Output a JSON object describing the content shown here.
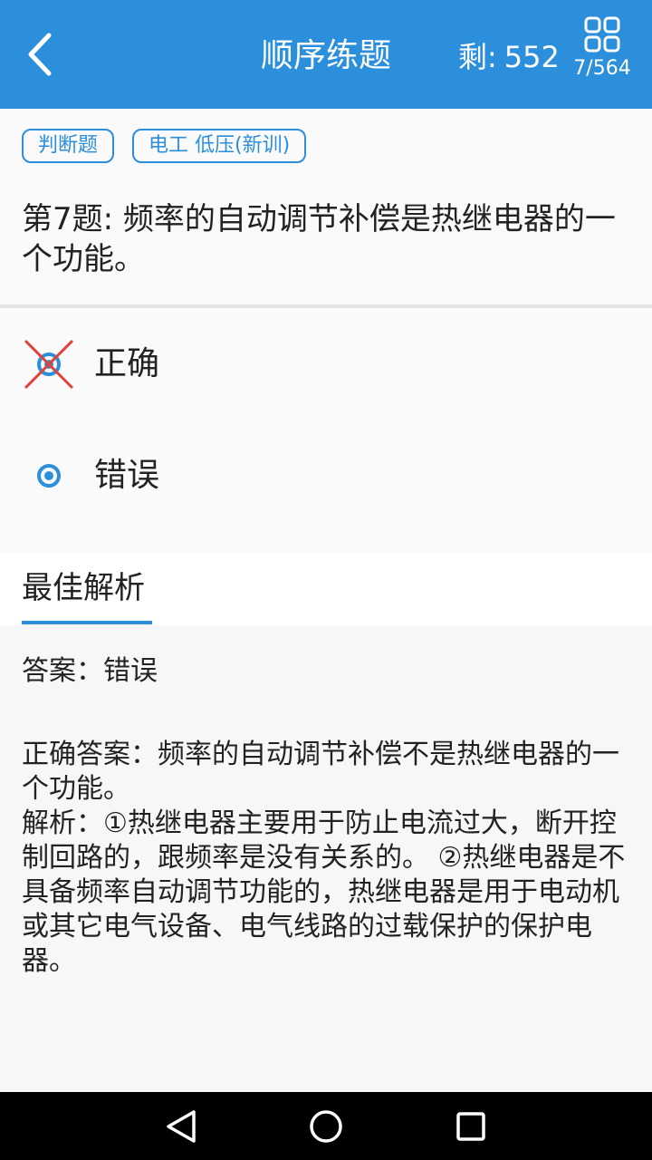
{
  "header": {
    "title": "顺序练题",
    "remaining_label": "剩:",
    "remaining_count": "552",
    "progress": "7/564",
    "bg_color": "#2b8fdc"
  },
  "question": {
    "tags": [
      "判断题",
      "电工 低压(新训)"
    ],
    "text": "第7题: 频率的自动调节补偿是热继电器的一个功能。"
  },
  "options": [
    {
      "label": "正确",
      "state": "wrong-selected",
      "icon": "wrong-x-icon"
    },
    {
      "label": "错误",
      "state": "correct",
      "icon": "radio-selected-icon"
    }
  ],
  "analysis": {
    "tab_label": "最佳解析",
    "answer_text": "答案：错误",
    "explanation_lines": [
      "正确答案：频率的自动调节补偿不是热继电器的一个功能。",
      "解析：①热继电器主要用于防止电流过大，断开控制回路的，跟频率是没有关系的。 ②热继电器是不具备频率自动调节功能的，热继电器是用于电动机或其它电气设备、电气线路的过载保护的保护电器。"
    ]
  },
  "navbar": {
    "buttons": [
      "back-triangle-icon",
      "home-circle-icon",
      "recents-square-icon"
    ]
  }
}
